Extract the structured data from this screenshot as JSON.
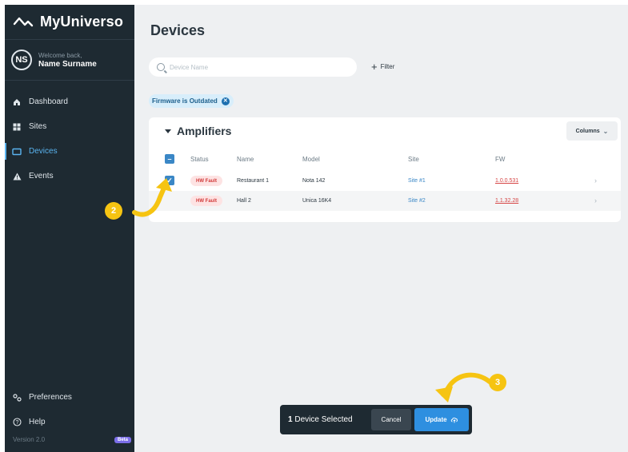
{
  "app": {
    "name": "MyUniverso"
  },
  "user": {
    "initials": "NS",
    "welcome": "Welcome back,",
    "name": "Name Surname"
  },
  "sidebar": {
    "items": [
      {
        "label": "Dashboard",
        "icon": "home-icon",
        "active": false
      },
      {
        "label": "Sites",
        "icon": "grid-icon",
        "active": false
      },
      {
        "label": "Devices",
        "icon": "devices-icon",
        "active": true
      },
      {
        "label": "Events",
        "icon": "alert-icon",
        "active": false
      }
    ],
    "bottom_items": [
      {
        "label": "Preferences",
        "icon": "preferences-icon"
      },
      {
        "label": "Help",
        "icon": "help-icon"
      }
    ],
    "version": "Version 2.0",
    "beta_badge": "Beta"
  },
  "page": {
    "title": "Devices"
  },
  "search": {
    "placeholder": "Device Name",
    "value": ""
  },
  "filter": {
    "label": "Filter"
  },
  "active_filter": {
    "label": "Firmware is Outdated"
  },
  "table": {
    "title": "Amplifiers",
    "columns_button": "Columns",
    "headers": [
      "Status",
      "Name",
      "Model",
      "Site",
      "FW"
    ],
    "rows": [
      {
        "status": "HW Fault",
        "name": "Restaurant 1",
        "model": "Nota 142",
        "site": "Site #1",
        "fw": "1.0.0.531",
        "checked": true
      },
      {
        "status": "HW Fault",
        "name": "Hall 2",
        "model": "Unica 16K4",
        "site": "Site #2",
        "fw": "1.1.32.28",
        "checked": false
      }
    ]
  },
  "action_bar": {
    "count": "1",
    "count_label": "Device Selected",
    "cancel": "Cancel",
    "update": "Update"
  },
  "callouts": [
    "2",
    "3"
  ],
  "colors": {
    "sidebar_bg": "#1e2a32",
    "accent": "#3a87c6",
    "fault": "#d23a3a",
    "callout": "#f6c412"
  }
}
